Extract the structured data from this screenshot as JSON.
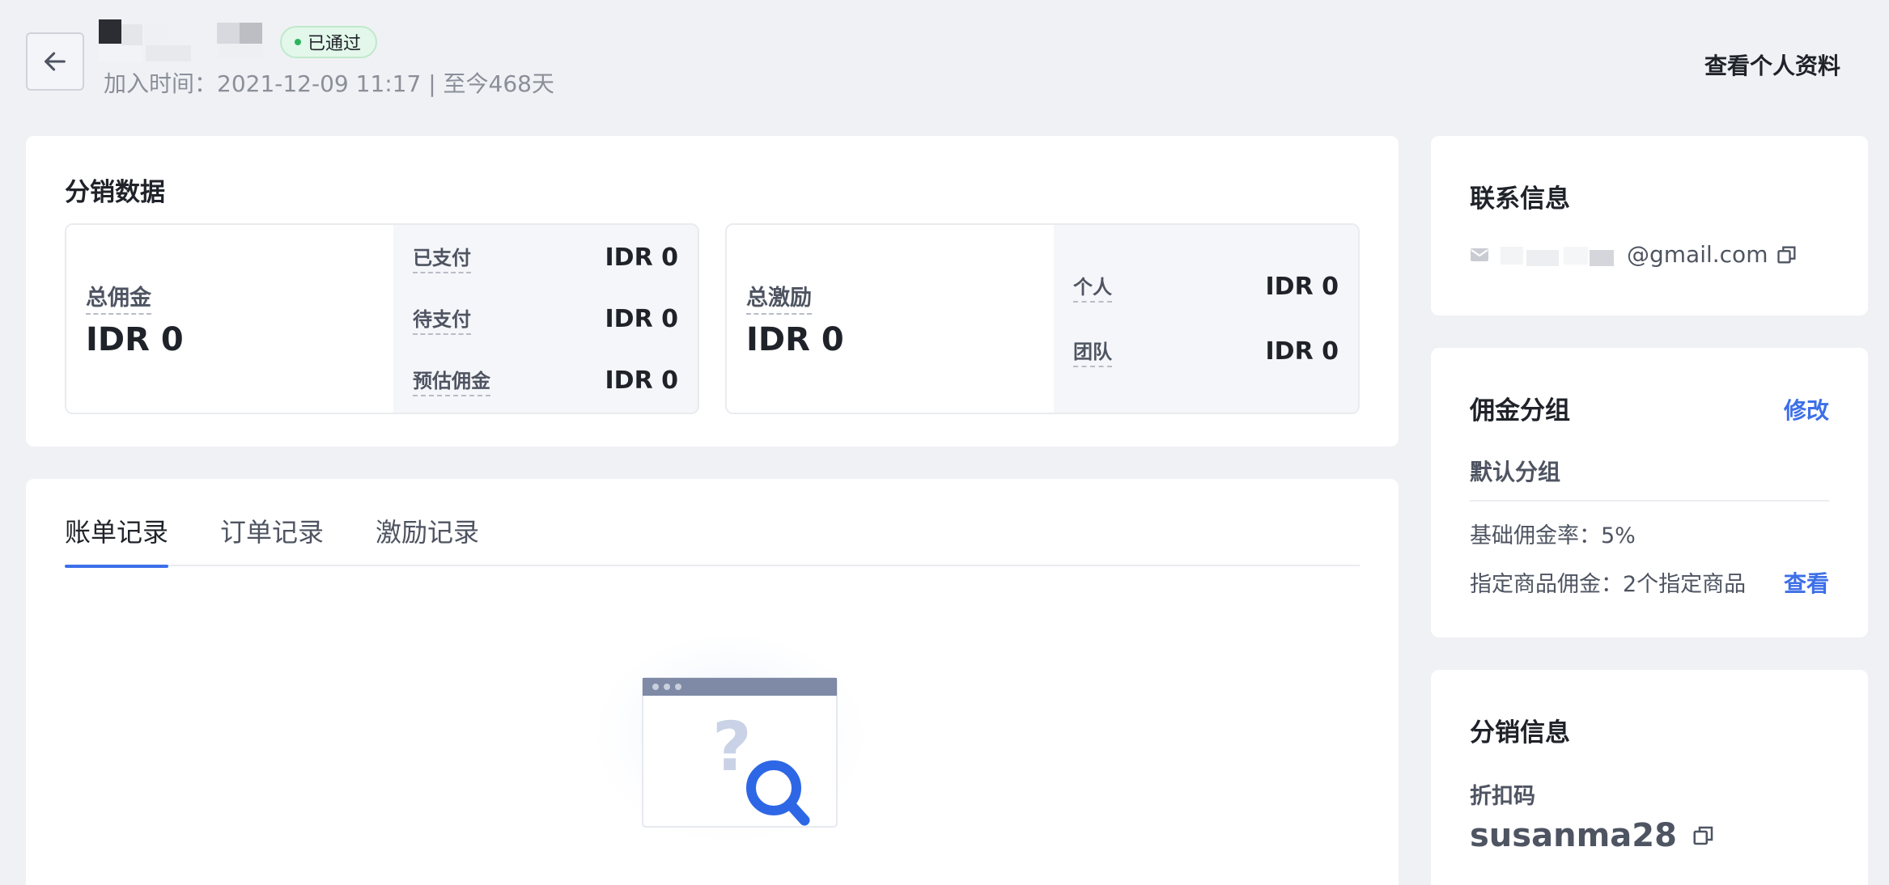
{
  "header": {
    "status_badge": "已通过",
    "join_info": "加入时间：2021-12-09 11:17 | 至今468天",
    "view_profile_label": "查看个人资料"
  },
  "distribution": {
    "title": "分销数据",
    "commission": {
      "total_label": "总佣金",
      "total_value": "IDR 0",
      "rows": [
        {
          "label": "已支付",
          "value": "IDR 0"
        },
        {
          "label": "待支付",
          "value": "IDR 0"
        },
        {
          "label": "预估佣金",
          "value": "IDR 0"
        }
      ]
    },
    "incentive": {
      "total_label": "总激励",
      "total_value": "IDR 0",
      "rows": [
        {
          "label": "个人",
          "value": "IDR 0"
        },
        {
          "label": "团队",
          "value": "IDR 0"
        }
      ]
    }
  },
  "records": {
    "tabs": [
      {
        "label": "账单记录",
        "active": true
      },
      {
        "label": "订单记录",
        "active": false
      },
      {
        "label": "激励记录",
        "active": false
      }
    ]
  },
  "contact": {
    "title": "联系信息",
    "email": "@gmail.com"
  },
  "commission_group": {
    "title": "佣金分组",
    "edit_label": "修改",
    "group_name": "默认分组",
    "base_rate": "基础佣金率：5%",
    "specified": "指定商品佣金：2个指定商品",
    "view_label": "查看"
  },
  "distribution_info": {
    "title": "分销信息",
    "code_label": "折扣码",
    "code_value": "susanma28"
  },
  "colors": {
    "accent": "#3d6fe8",
    "success": "#2bb55e",
    "background": "#f0f1f5"
  }
}
